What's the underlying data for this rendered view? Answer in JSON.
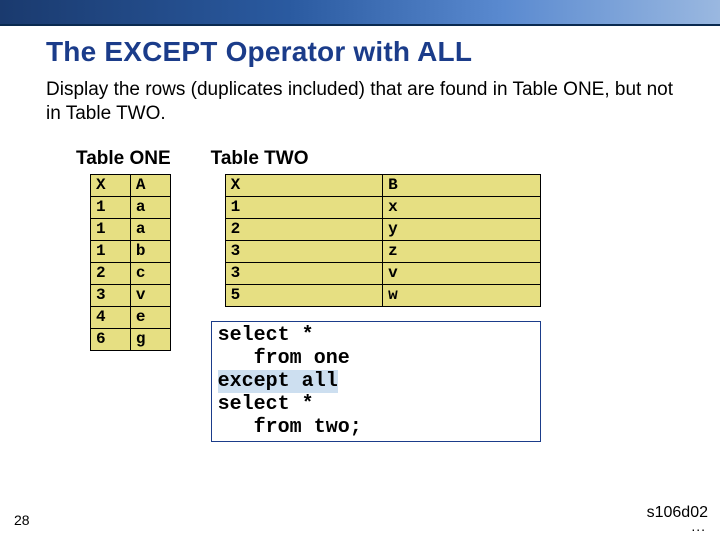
{
  "title": "The EXCEPT Operator with ALL",
  "description": "Display the rows (duplicates included) that are found in Table ONE, but not in Table TWO.",
  "table_one": {
    "caption": "Table ONE",
    "headers": [
      "X",
      "A"
    ],
    "rows": [
      [
        "1",
        "a"
      ],
      [
        "1",
        "a"
      ],
      [
        "1",
        "b"
      ],
      [
        "2",
        "c"
      ],
      [
        "3",
        "v"
      ],
      [
        "4",
        "e"
      ],
      [
        "6",
        "g"
      ]
    ]
  },
  "table_two": {
    "caption": "Table TWO",
    "headers": [
      "X",
      "B"
    ],
    "rows": [
      [
        "1",
        "x"
      ],
      [
        "2",
        "y"
      ],
      [
        "3",
        "z"
      ],
      [
        "3",
        "v"
      ],
      [
        "5",
        "w"
      ]
    ]
  },
  "code": {
    "line1": "select *",
    "line2": "   from one",
    "line3": "except all",
    "line4": "select *",
    "line5": "   from two;"
  },
  "slide_number": "28",
  "reference_id": "s106d02",
  "dots": "..."
}
